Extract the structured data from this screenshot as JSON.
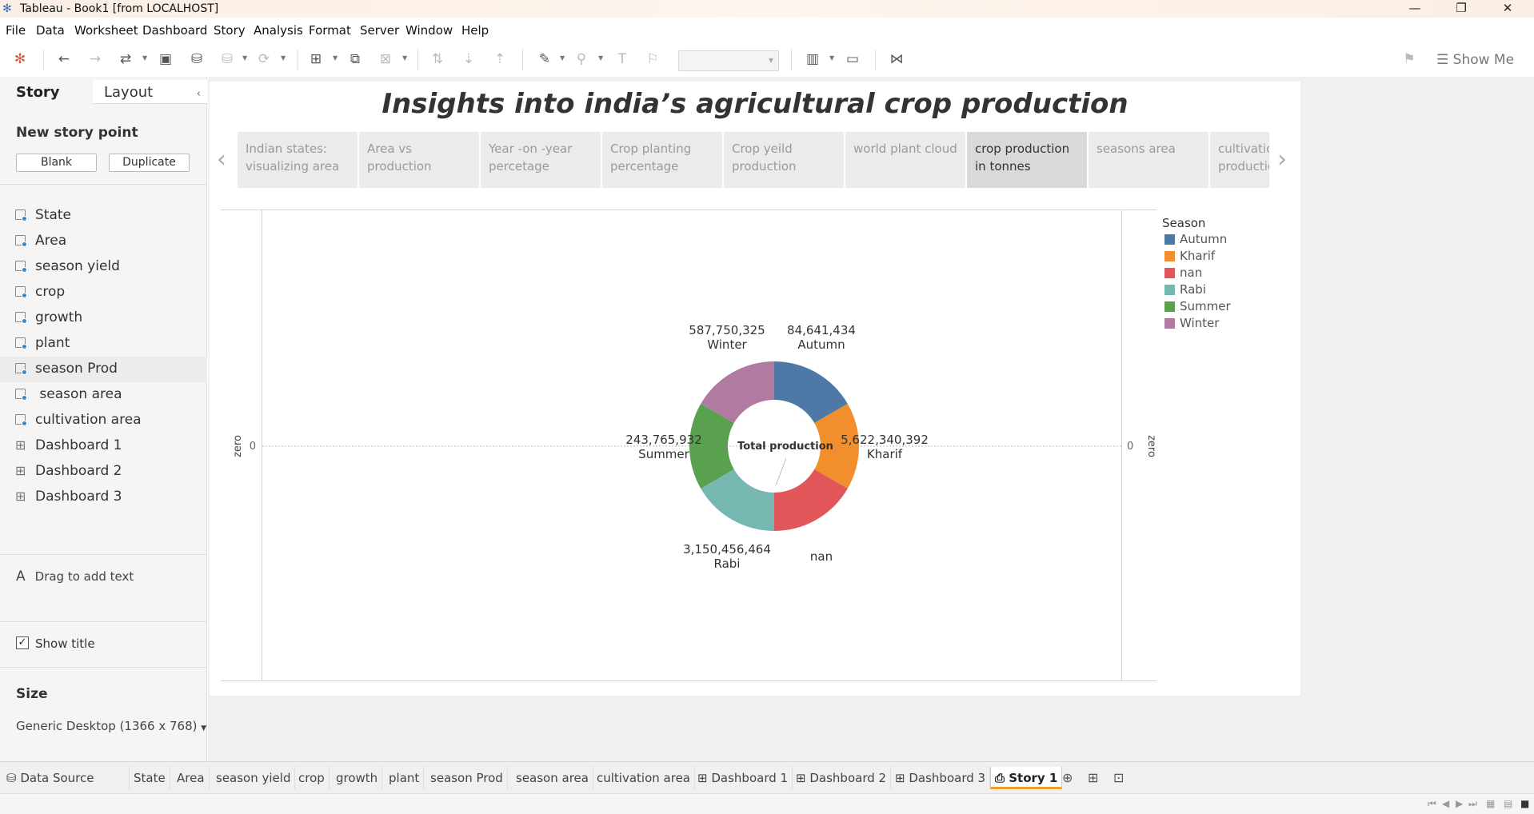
{
  "window": {
    "title": "Tableau - Book1 [from LOCALHOST]"
  },
  "menu": [
    "File",
    "Data",
    "Worksheet",
    "Dashboard",
    "Story",
    "Analysis",
    "Format",
    "Server",
    "Window",
    "Help"
  ],
  "toolbar": {
    "show_me": "Show Me"
  },
  "left_panel": {
    "tabs": {
      "story": "Story",
      "layout": "Layout"
    },
    "new_story_point": "New story point",
    "blank_label": "Blank",
    "duplicate_label": "Duplicate",
    "sheets": [
      {
        "label": "State",
        "kind": "sheet"
      },
      {
        "label": "Area",
        "kind": "sheet"
      },
      {
        "label": "season yield",
        "kind": "sheet"
      },
      {
        "label": "crop",
        "kind": "sheet"
      },
      {
        "label": "growth",
        "kind": "sheet"
      },
      {
        "label": "plant",
        "kind": "sheet"
      },
      {
        "label": "season Prod",
        "kind": "sheet"
      },
      {
        "label": " season area",
        "kind": "sheet"
      },
      {
        "label": "cultivation area",
        "kind": "sheet"
      },
      {
        "label": "Dashboard 1",
        "kind": "dashboard"
      },
      {
        "label": "Dashboard 2",
        "kind": "dashboard"
      },
      {
        "label": "Dashboard 3",
        "kind": "dashboard"
      }
    ],
    "drag_text": "Drag to add text",
    "show_title": "Show title",
    "size_heading": "Size",
    "size_value": "Generic Desktop (1366 x 768)"
  },
  "story": {
    "title": "Insights into india’s agricultural crop production",
    "points": [
      "Indian  states: visualizing area",
      "Area vs production",
      "Year -on -year percetage",
      "Crop planting percentage",
      "Crop yeild production",
      "world plant cloud",
      "crop production in tonnes",
      "seasons area",
      "cultivation production"
    ],
    "active_point": 6
  },
  "viz": {
    "axis_left_title": "zero",
    "axis_left_tick": "0",
    "axis_right_title": "zero",
    "axis_right_tick": "0",
    "center_label": "Total production"
  },
  "legend": {
    "title": "Season"
  },
  "chart_data": {
    "type": "pie",
    "donut": true,
    "categories": [
      "Autumn",
      "Kharif",
      "nan",
      "Rabi",
      "Summer",
      "Winter"
    ],
    "values": [
      84641434,
      5622340392,
      null,
      3150456464,
      243765932,
      587750325
    ],
    "labels": [
      "84,641,434",
      "5,622,340,392",
      "",
      "3,150,456,464",
      "243,765,932",
      "587,750,325"
    ],
    "colors": [
      "#4e79a7",
      "#f28e2b",
      "#e15759",
      "#76b7b2",
      "#59a14f",
      "#b07aa1"
    ]
  },
  "bottom_tabs": {
    "data_source": "Data Source",
    "sheets": [
      "State",
      "Area",
      "season yield",
      "crop",
      "growth",
      "plant",
      "season Prod",
      "season area",
      "cultivation area"
    ],
    "dashboards": [
      "Dashboard 1",
      "Dashboard 2",
      "Dashboard 3"
    ],
    "story": "Story 1"
  }
}
